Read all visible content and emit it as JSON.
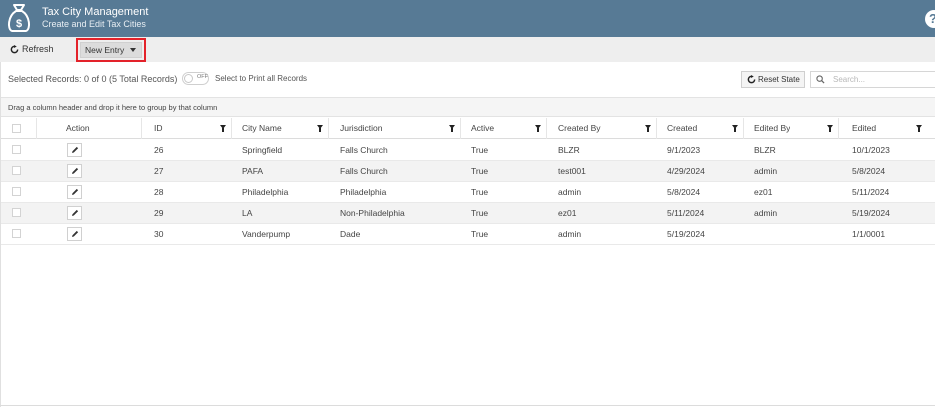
{
  "header": {
    "title": "Tax City Management",
    "subtitle": "Create and Edit Tax Cities",
    "logo_icon": "money-bag-icon",
    "help_icon": "help-icon",
    "background": "#577a95"
  },
  "toolbar": {
    "refresh_label": "Refresh",
    "new_entry_label": "New Entry",
    "highlight_color": "#e3222a"
  },
  "status": {
    "selected_text": "Selected Records: 0 of 0 (5 Total Records)",
    "toggle_state": "OFF",
    "print_all_label": "Select to Print all Records",
    "reset_label": "Reset State",
    "search_placeholder": "Search..."
  },
  "group_bar": {
    "text": "Drag a column header and drop it here to group by that column"
  },
  "columns": [
    "Action",
    "ID",
    "City Name",
    "Jurisdiction",
    "Active",
    "Created By",
    "Created",
    "Edited By",
    "Edited"
  ],
  "rows": [
    {
      "id": "26",
      "city": "Springfield",
      "jurisdiction": "Falls Church",
      "active": "True",
      "created_by": "BLZR",
      "created": "9/1/2023",
      "edited_by": "BLZR",
      "edited": "10/1/2023"
    },
    {
      "id": "27",
      "city": "PAFA",
      "jurisdiction": "Falls Church",
      "active": "True",
      "created_by": "test001",
      "created": "4/29/2024",
      "edited_by": "admin",
      "edited": "5/8/2024"
    },
    {
      "id": "28",
      "city": "Philadelphia",
      "jurisdiction": "Philadelphia",
      "active": "True",
      "created_by": "admin",
      "created": "5/8/2024",
      "edited_by": "ez01",
      "edited": "5/11/2024"
    },
    {
      "id": "29",
      "city": "LA",
      "jurisdiction": "Non-Philadelphia",
      "active": "True",
      "created_by": "ez01",
      "created": "5/11/2024",
      "edited_by": "admin",
      "edited": "5/19/2024"
    },
    {
      "id": "30",
      "city": "Vanderpump",
      "jurisdiction": "Dade",
      "active": "True",
      "created_by": "admin",
      "created": "5/19/2024",
      "edited_by": "",
      "edited": "1/1/0001"
    }
  ]
}
